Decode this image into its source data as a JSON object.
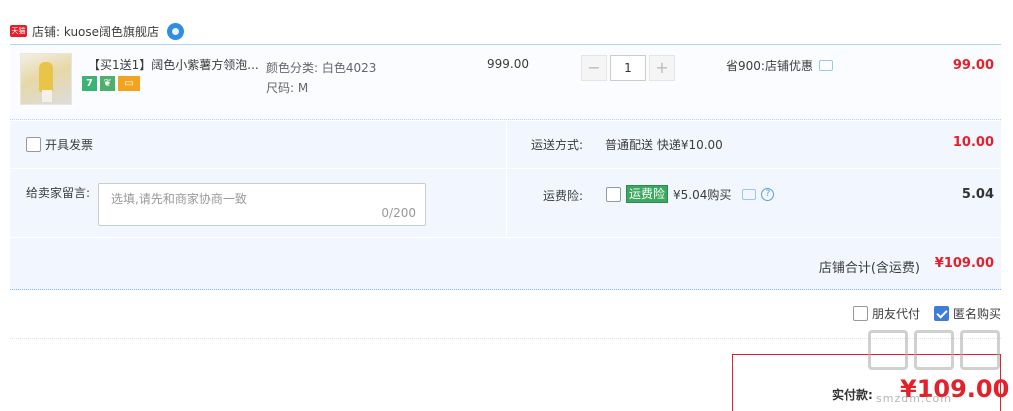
{
  "shop": {
    "tmall_badge": "天猫",
    "label": "店铺: kuose阔色旗舰店"
  },
  "item": {
    "title": "【买1送1】阔色小紫薯方领泡...",
    "badges": [
      "7"
    ],
    "sku_color": "颜色分类: 白色4023",
    "sku_size": "尺码: M",
    "unit_price": "999.00",
    "qty_minus": "−",
    "quantity": "1",
    "qty_plus": "+",
    "discount": "省900:店铺优惠",
    "total": "99.00"
  },
  "invoice": {
    "label": "开具发票"
  },
  "message": {
    "label": "给卖家留言:",
    "placeholder": "选填,请先和商家协商一致",
    "count": "0/200"
  },
  "shipping": {
    "label": "运送方式:",
    "value": "普通配送 快递¥10.00",
    "fee": "10.00"
  },
  "insurance": {
    "label": "运费险:",
    "tag": "运费险",
    "price": "¥5.04购买",
    "help": "?",
    "fee": "5.04"
  },
  "shop_total": {
    "label": "店铺合计(含运费)",
    "value": "¥109.00"
  },
  "options": {
    "friend_pay": "朋友代付",
    "anonymous": "匿名购买"
  },
  "payment": {
    "label": "实付款:",
    "amount": "¥109.00"
  },
  "watermark": {
    "url": "smzdm.com"
  }
}
